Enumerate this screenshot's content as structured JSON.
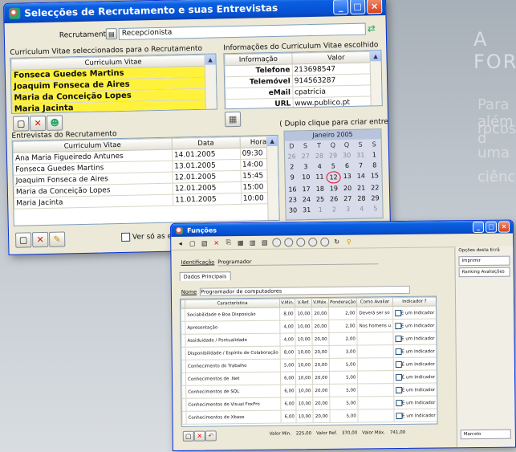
{
  "background": {
    "heading": "A FORM",
    "lines": [
      "Para além d",
      "rocos",
      "uma",
      "ciência"
    ]
  },
  "window1": {
    "title": "Selecções de Recrutamento e suas Entrevistas",
    "recrutamento_label": "Recrutamento",
    "recrutamento_value": "Recepcionista",
    "cv_section_label": "Curriculum Vitae seleccionados para o Recrutamento",
    "cv_column": "Curriculum Vitae",
    "cv_list": [
      "Fonseca Guedes Martins",
      "Joaquim Fonseca de Aires",
      "Maria da Conceição Lopes",
      "Maria Jacinta"
    ],
    "info_section_label": "Informações do Curriculum Vitae escolhido",
    "info_columns": [
      "Informação",
      "Valor"
    ],
    "info_rows": [
      {
        "label": "Telefone",
        "value": "213698547"
      },
      {
        "label": "Telemóvel",
        "value": "914563287"
      },
      {
        "label": "eMail",
        "value": "cpatricia"
      },
      {
        "label": "URL",
        "value": "www.publico.pt"
      }
    ],
    "interviews_label": "Entrevistas do Recrutamento",
    "hint": "( Duplo clique para criar entrevista )",
    "interview_columns": [
      "Curriculum Vitae",
      "Data",
      "Hora"
    ],
    "interviews": [
      {
        "cv": "Ana Maria Figueiredo Antunes",
        "data": "14.01.2005",
        "hora": "09:30"
      },
      {
        "cv": "Fonseca Guedes Martins",
        "data": "13.01.2005",
        "hora": "14:00"
      },
      {
        "cv": "Joaquim Fonseca de Aires",
        "data": "12.01.2005",
        "hora": "15:45"
      },
      {
        "cv": "Maria da Conceição Lopes",
        "data": "12.01.2005",
        "hora": "15:00"
      },
      {
        "cv": "Maria Jacinta",
        "data": "11.01.2005",
        "hora": "10:00"
      }
    ],
    "only_between_label": "Ver só as entre",
    "calendar": {
      "month": "Janeiro 2005",
      "weekdays": [
        "D",
        "S",
        "T",
        "Q",
        "Q",
        "S",
        "S"
      ],
      "days": [
        "26",
        "27",
        "28",
        "29",
        "30",
        "31",
        "1",
        "2",
        "3",
        "4",
        "5",
        "6",
        "7",
        "8",
        "9",
        "10",
        "11",
        "12",
        "13",
        "14",
        "15",
        "16",
        "17",
        "18",
        "19",
        "20",
        "21",
        "22",
        "23",
        "24",
        "25",
        "26",
        "27",
        "28",
        "29",
        "30",
        "31",
        "1",
        "2",
        "3",
        "4",
        "5"
      ],
      "selected_day": "12"
    }
  },
  "window2": {
    "title": "Funções",
    "identificacao_label": "Identificação",
    "identificacao_value": "Programador",
    "tab": "Dados Principais",
    "nome_label": "Nome",
    "nome_value": "Programador de computadores",
    "columns": [
      "Característica",
      "V.Min.",
      "V.Ref.",
      "V.Máx.",
      "Ponderação",
      "Como Avaliar",
      "Indicador ?"
    ],
    "rows": [
      {
        "c": "Sociabilidade e Boa Disposição",
        "min": "8,00",
        "ref": "10,00",
        "max": "20,00",
        "pond": "2,00",
        "como": "Deverá ser so",
        "ind": "É um Indicador"
      },
      {
        "c": "Apresentação",
        "min": "4,00",
        "ref": "10,00",
        "max": "20,00",
        "pond": "2,00",
        "como": "Nos homens u",
        "ind": "É um Indicador"
      },
      {
        "c": "Assiduidade / Pontualidade",
        "min": "4,00",
        "ref": "10,00",
        "max": "20,00",
        "pond": "2,00",
        "como": "",
        "ind": "É um Indicador"
      },
      {
        "c": "Disponibilidade / Espírito de Colaboração",
        "min": "8,00",
        "ref": "10,00",
        "max": "20,00",
        "pond": "3,00",
        "como": "",
        "ind": "É um Indicador"
      },
      {
        "c": "Conhecimento do Trabalho",
        "min": "5,00",
        "ref": "10,00",
        "max": "20,00",
        "pond": "5,00",
        "como": "",
        "ind": "É um Indicador"
      },
      {
        "c": "Conhecimentos de .Net",
        "min": "6,00",
        "ref": "10,00",
        "max": "20,00",
        "pond": "5,00",
        "como": "",
        "ind": "É um Indicador"
      },
      {
        "c": "Conhecimentos de SQL",
        "min": "6,00",
        "ref": "10,00",
        "max": "20,00",
        "pond": "5,00",
        "como": "",
        "ind": "É um Indicador"
      },
      {
        "c": "Conhecimentos de Visual FoxPro",
        "min": "6,00",
        "ref": "10,00",
        "max": "20,00",
        "pond": "5,00",
        "como": "",
        "ind": "É um Indicador"
      },
      {
        "c": "Conhecimentos de Xbase",
        "min": "6,00",
        "ref": "10,00",
        "max": "20,00",
        "pond": "5,00",
        "como": "",
        "ind": "É um Indicador"
      }
    ],
    "footer": {
      "min_label": "Valor Min.",
      "min_value": "225,00",
      "ref_label": "Valor Ref.",
      "ref_value": "370,00",
      "max_label": "Valor Máx.",
      "max_value": "741,00"
    },
    "side": {
      "title": "Opções desta Ecrã",
      "buttons": [
        "Imprimir",
        "Ranking Avaliações"
      ],
      "bottom": "Marcelo"
    }
  }
}
